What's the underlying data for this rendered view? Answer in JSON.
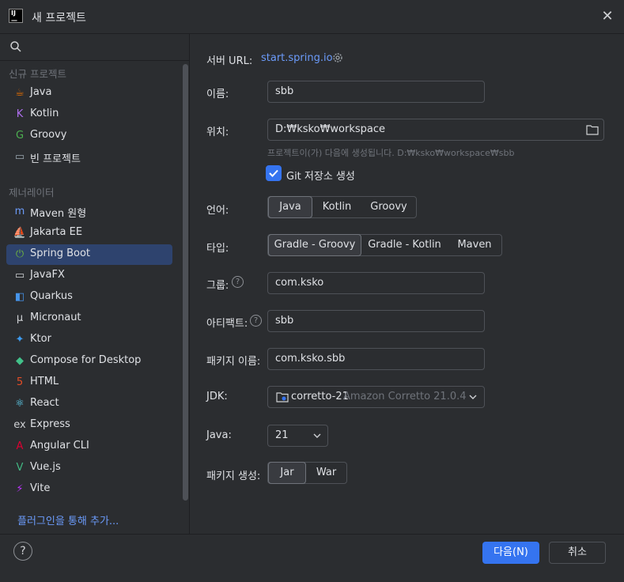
{
  "window": {
    "title": "새 프로젝트"
  },
  "sidebar": {
    "section_new": "신규 프로젝트",
    "section_generators": "제너레이터",
    "new_items": [
      {
        "label": "Java",
        "icon": "java-icon",
        "color": "#e76f00"
      },
      {
        "label": "Kotlin",
        "icon": "kotlin-icon",
        "color": "#b070f0"
      },
      {
        "label": "Groovy",
        "icon": "groovy-icon",
        "color": "#4caf50"
      },
      {
        "label": "빈 프로젝트",
        "icon": "empty-project-icon",
        "color": "#9aa7b0"
      }
    ],
    "generator_items": [
      {
        "label": "Maven 원형",
        "icon": "maven-icon",
        "color": "#6b9bfa"
      },
      {
        "label": "Jakarta EE",
        "icon": "jakarta-icon",
        "color": "#f5a623"
      },
      {
        "label": "Spring Boot",
        "icon": "spring-icon",
        "color": "#6db33f"
      },
      {
        "label": "JavaFX",
        "icon": "javafx-icon",
        "color": "#cfd1d4"
      },
      {
        "label": "Quarkus",
        "icon": "quarkus-icon",
        "color": "#4695eb"
      },
      {
        "label": "Micronaut",
        "icon": "micronaut-icon",
        "color": "#cfd1d4"
      },
      {
        "label": "Ktor",
        "icon": "ktor-icon",
        "color": "#3d9bf0"
      },
      {
        "label": "Compose for Desktop",
        "icon": "compose-icon",
        "color": "#42c18a"
      },
      {
        "label": "HTML",
        "icon": "html-icon",
        "color": "#e44d26"
      },
      {
        "label": "React",
        "icon": "react-icon",
        "color": "#61dafb"
      },
      {
        "label": "Express",
        "icon": "express-icon",
        "color": "#cfd1d4"
      },
      {
        "label": "Angular CLI",
        "icon": "angular-icon",
        "color": "#dd0031"
      },
      {
        "label": "Vue.js",
        "icon": "vue-icon",
        "color": "#42b883"
      },
      {
        "label": "Vite",
        "icon": "vite-icon",
        "color": "#bd34fe"
      }
    ],
    "selected": "Spring Boot",
    "plugins_link": "플러그인을 통해 추가..."
  },
  "form": {
    "server_url_label": "서버 URL:",
    "server_url_value": "start.spring.io",
    "name_label": "이름:",
    "name_value": "sbb",
    "location_label": "위치:",
    "location_value": "D:₩ksko₩workspace",
    "location_hint": "프로젝트이(가) 다음에 생성됩니다. D:₩ksko₩workspace₩sbb",
    "git_label": "Git 저장소 생성",
    "git_checked": true,
    "language_label": "언어:",
    "language_options": [
      "Java",
      "Kotlin",
      "Groovy"
    ],
    "language_selected": "Java",
    "type_label": "타입:",
    "type_options": [
      "Gradle - Groovy",
      "Gradle - Kotlin",
      "Maven"
    ],
    "type_selected": "Gradle - Groovy",
    "group_label": "그룹:",
    "group_value": "com.ksko",
    "artifact_label": "아티팩트:",
    "artifact_value": "sbb",
    "package_label": "패키지 이름:",
    "package_value": "com.ksko.sbb",
    "jdk_label": "JDK:",
    "jdk_value": "corretto-21",
    "jdk_detail": "Amazon Corretto 21.0.4",
    "java_label": "Java:",
    "java_value": "21",
    "packaging_label": "패키지 생성:",
    "packaging_options": [
      "Jar",
      "War"
    ],
    "packaging_selected": "Jar"
  },
  "footer": {
    "help": "?",
    "next": "다음(N)",
    "cancel": "취소"
  },
  "colors": {
    "accent": "#3574f0",
    "link": "#6b9bfa",
    "selection": "#2e436e"
  }
}
